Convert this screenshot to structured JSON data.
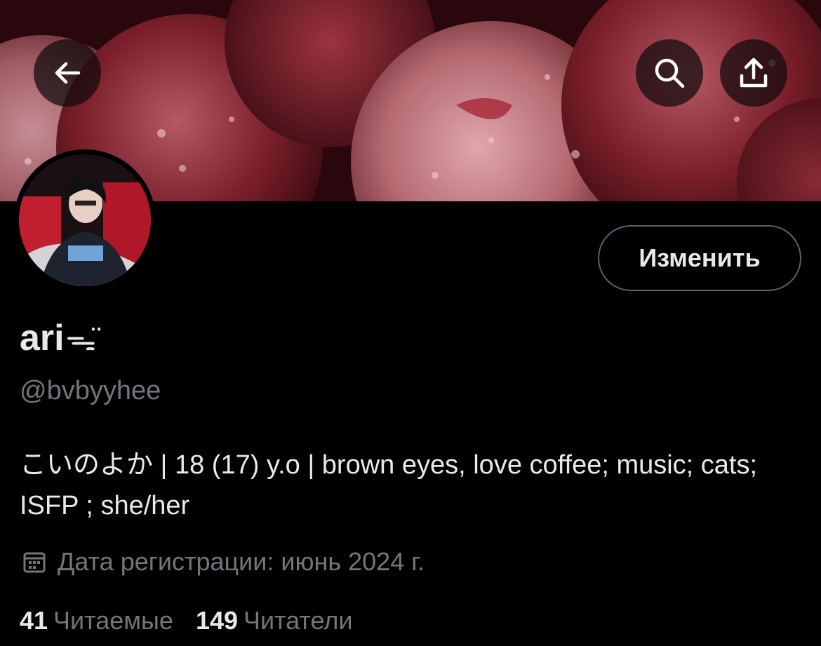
{
  "header": {
    "back_icon": "arrow-left-icon",
    "search_icon": "search-icon",
    "share_icon": "share-upload-icon",
    "banner_colors": [
      "#3a0d12",
      "#8a2a33",
      "#c27b84"
    ]
  },
  "profile": {
    "edit_label": "Изменить",
    "name": "ari",
    "name_emoji": "ᯓ̈",
    "handle": "@bvbyyhee",
    "bio": "こいのよか | 18 (17) y.o | brown eyes, love coffee; music; cats; ISFP ; she/her",
    "joined_icon": "calendar-icon",
    "joined": "Дата регистрации: июнь 2024 г."
  },
  "stats": {
    "following_count": "41",
    "following_label": "Читаемые",
    "followers_count": "149",
    "followers_label": "Читатели"
  }
}
